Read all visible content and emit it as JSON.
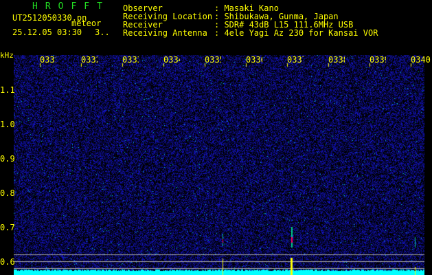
{
  "header": {
    "title": "HROFFT",
    "filename": "UT2512050330.pn",
    "mode": "meteor",
    "datetime": "25.12.05 03:30",
    "count": "3..",
    "info": [
      {
        "label": "Observer",
        "value": ": Masaki Kano"
      },
      {
        "label": "Receiving Location",
        "value": ": Shibukawa, Gunma, Japan"
      },
      {
        "label": "Receiver",
        "value": ": SDR# 43dB L15 111.6MHz USB"
      },
      {
        "label": "Receiving Antenna",
        "value": ": 4ele Yagi Az 230 for Kansai VOR"
      }
    ]
  },
  "axes": {
    "y_unit": "kHz",
    "y_ticks": [
      "1.1",
      "1.0",
      "0.9",
      "0.8",
      "0.7",
      "0.6"
    ],
    "x_ticks": [
      "0331",
      "0332",
      "0333",
      "0334",
      "0335",
      "0336",
      "0337",
      "0338",
      "0339",
      "0340"
    ]
  },
  "colors": {
    "background": "#000000",
    "noise": "#1a1aa0",
    "baseline": "#00ffff",
    "labels": "#ffff00",
    "title": "#22dd22",
    "meteor": "#ff0066"
  }
}
